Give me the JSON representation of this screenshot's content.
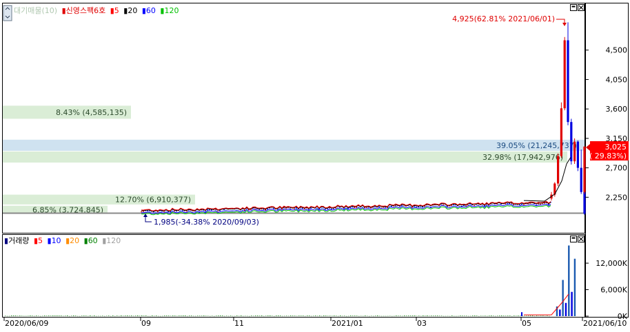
{
  "price_legend": {
    "icon": "sort-icon",
    "indicator": "대기매물(10)",
    "stock": "신영스팩6호",
    "ma": [
      {
        "label": "5",
        "color": "#ff0000"
      },
      {
        "label": "20",
        "color": "#000000"
      },
      {
        "label": "60",
        "color": "#0000ff"
      },
      {
        "label": "120",
        "color": "#00c000"
      }
    ]
  },
  "volume_legend": {
    "title": "거래량",
    "ma": [
      {
        "label": "5",
        "color": "#ff0000"
      },
      {
        "label": "10",
        "color": "#0000ff"
      },
      {
        "label": "20",
        "color": "#ff8c00"
      },
      {
        "label": "60",
        "color": "#008000"
      },
      {
        "label": "120",
        "color": "#a0a0a0"
      }
    ]
  },
  "current": {
    "price": "3,025",
    "change": "( 29.83%)"
  },
  "annotations": {
    "high": "4,925(62.81% 2021/06/01)",
    "low": "1,985(-34.38% 2020/09/03)"
  },
  "chart_data": [
    {
      "type": "candlestick",
      "y_ticks": [
        "4,500",
        "4,050",
        "3,600",
        "3,150",
        "2,700",
        "2,250"
      ],
      "y_tick_values": [
        4500,
        4050,
        3600,
        3150,
        2700,
        2250
      ],
      "ylim": [
        1980,
        4950
      ],
      "x_ticks": [
        "2020/06/09",
        "09",
        "11",
        "2021/01",
        "03",
        "05",
        "2021/06/10"
      ],
      "volume_profile": [
        {
          "label": "8.43% (4,585,135)",
          "price_low": 3450,
          "price_high": 3650
        },
        {
          "label": "39.05% (21,245,737)",
          "price_low": 2960,
          "price_high": 3130
        },
        {
          "label": "32.98% (17,942,976)",
          "price_low": 2780,
          "price_high": 2950
        },
        {
          "label": "12.70% (6,910,377)",
          "price_low": 2140,
          "price_high": 2290
        },
        {
          "label": "6.85% (3,724,845)",
          "price_low": 2000,
          "price_high": 2120
        }
      ],
      "recent_candles": [
        {
          "date": "2021/05/25",
          "open": 2230,
          "high": 2330,
          "low": 2200,
          "close": 2290
        },
        {
          "date": "2021/05/26",
          "open": 2290,
          "high": 2480,
          "low": 2260,
          "close": 2460
        },
        {
          "date": "2021/05/27",
          "open": 2460,
          "high": 2920,
          "low": 2420,
          "close": 2880
        },
        {
          "date": "2021/05/28",
          "open": 2880,
          "high": 3700,
          "low": 2850,
          "close": 3610
        },
        {
          "date": "2021/05/31",
          "open": 3610,
          "high": 4700,
          "low": 3580,
          "close": 4650
        },
        {
          "date": "2021/06/01",
          "open": 4650,
          "high": 4925,
          "low": 3350,
          "close": 3400
        },
        {
          "date": "2021/06/02",
          "open": 3400,
          "high": 3450,
          "low": 2750,
          "close": 2800
        },
        {
          "date": "2021/06/03",
          "open": 2800,
          "high": 3150,
          "low": 2760,
          "close": 3100
        },
        {
          "date": "2021/06/04",
          "open": 3100,
          "high": 3120,
          "low": 2650,
          "close": 2700
        },
        {
          "date": "2021/06/07",
          "open": 2700,
          "high": 2980,
          "low": 2300,
          "close": 2330
        },
        {
          "date": "2021/06/08",
          "open": 2330,
          "high": 2380,
          "low": 1980,
          "close": 2000
        },
        {
          "date": "2021/06/10",
          "open": 2330,
          "high": 3025,
          "low": 2300,
          "close": 3025
        }
      ],
      "min_annotation": {
        "date": "2020/09/03",
        "value": 1985
      },
      "max_annotation": {
        "date": "2021/06/01",
        "value": 4925
      }
    },
    {
      "type": "bar",
      "y_ticks": [
        "12,000K",
        "6,000K",
        "0K"
      ],
      "y_tick_values": [
        12000,
        6000,
        0
      ],
      "ylim": [
        0,
        17000
      ],
      "unit": "K",
      "recent_volume": [
        {
          "date": "2021/05/25",
          "value": 2200
        },
        {
          "date": "2021/05/26",
          "value": 1500
        },
        {
          "date": "2021/05/27",
          "value": 8200
        },
        {
          "date": "2021/05/28",
          "value": 3000
        },
        {
          "date": "2021/05/31",
          "value": 16000
        },
        {
          "date": "2021/06/01",
          "value": 5500
        },
        {
          "date": "2021/06/02",
          "value": 13000
        }
      ]
    }
  ]
}
